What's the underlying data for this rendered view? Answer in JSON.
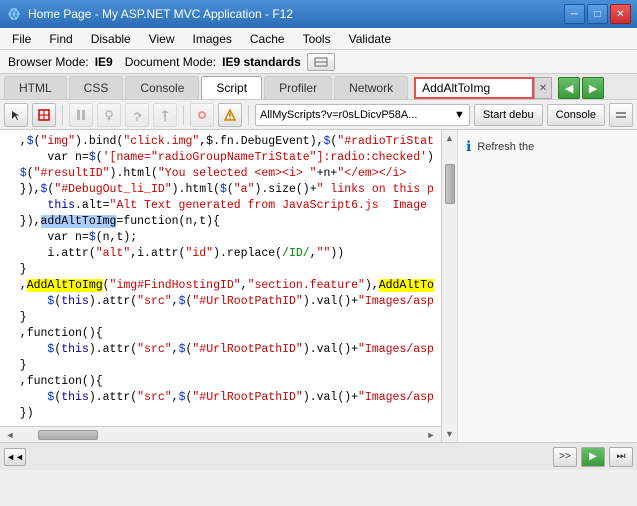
{
  "titleBar": {
    "icon": "◈",
    "title": "Home Page - My ASP.NET MVC Application - F12",
    "minimize": "─",
    "maximize": "□",
    "close": "✕"
  },
  "menuBar": {
    "items": [
      "File",
      "Find",
      "Disable",
      "View",
      "Images",
      "Cache",
      "Tools",
      "Validate"
    ]
  },
  "infoBar": {
    "browserModeLabel": "Browser Mode:",
    "browserMode": "IE9",
    "docModeLabel": "Document Mode:",
    "docMode": "IE9 standards"
  },
  "tabs1": {
    "items": [
      "HTML",
      "CSS",
      "Console",
      "Script",
      "Profiler",
      "Network"
    ],
    "active": "Script",
    "searchValue": "AddAltToImg"
  },
  "toolbar": {
    "dropdownValue": "AllMyScripts?v=r0sLDicvP58A...",
    "dropdownArrow": "▼",
    "startDebug": "Start debu",
    "console": "Console"
  },
  "code": {
    "lines": [
      {
        "text": "  ,$(\"img\").bind(\"click.img\",$.fn.DebugEvent),$(\"#radioTriStat",
        "hasHighlight": false
      },
      {
        "text": "      var n=$('[name=\"radioGroupNameTriState\"]:radio:checked')",
        "hasHighlight": false
      },
      {
        "text": "  $(\"#resultID\").html(\"You selected <em><i> \"+n+\"</em></i>",
        "hasHighlight": false
      },
      {
        "text": "  }),$(\"#DebugOut_li_ID\").html($(\"a\").size()+\" links on this p",
        "hasHighlight": false
      },
      {
        "text": "      this.alt=\"Alt Text generated from JavaScript6.js  Image",
        "hasHighlight": false
      },
      {
        "text": "  }),addAltToImg=function(n,t){",
        "highlight": "addAltToImg",
        "hasHighlight": true,
        "highlightColor": "blue"
      },
      {
        "text": "      var n=$(n,t);",
        "hasHighlight": false
      },
      {
        "text": "      i.attr(\"alt\",i.attr(\"id\").replace(/ID/,\"\"))",
        "hasHighlight": false
      },
      {
        "text": "  }",
        "hasHighlight": false
      },
      {
        "text": "  ,AddAltToImg(\"img#FindHostingID\",\"section.feature\"),AddAltTo",
        "highlight": "AddAltToImg",
        "hasHighlight": true,
        "highlightColor": "yellow"
      },
      {
        "text": "      $(this).attr(\"src\",$(\"#UrlRootPathID\").val()+\"Images/asp",
        "hasHighlight": false
      },
      {
        "text": "  }",
        "hasHighlight": false
      },
      {
        "text": "  ,function(){",
        "hasHighlight": false
      },
      {
        "text": "      $(this).attr(\"src\",$(\"#UrlRootPathID\").val()+\"Images/asp",
        "hasHighlight": false
      },
      {
        "text": "  }",
        "hasHighlight": false
      },
      {
        "text": "  ,function(){",
        "hasHighlight": false
      },
      {
        "text": "      $(this).attr(\"src\",$(\"#UrlRootPathID\").val()+\"Images/asp",
        "hasHighlight": false
      },
      {
        "text": "  })",
        "hasHighlight": false
      }
    ]
  },
  "rightPanel": {
    "refreshText": "Refresh the"
  },
  "bottomBar": {
    "scrollLabel": "◄◄",
    "navNext": ">>",
    "navPlay": "▶",
    "navSkip": "⏭"
  }
}
